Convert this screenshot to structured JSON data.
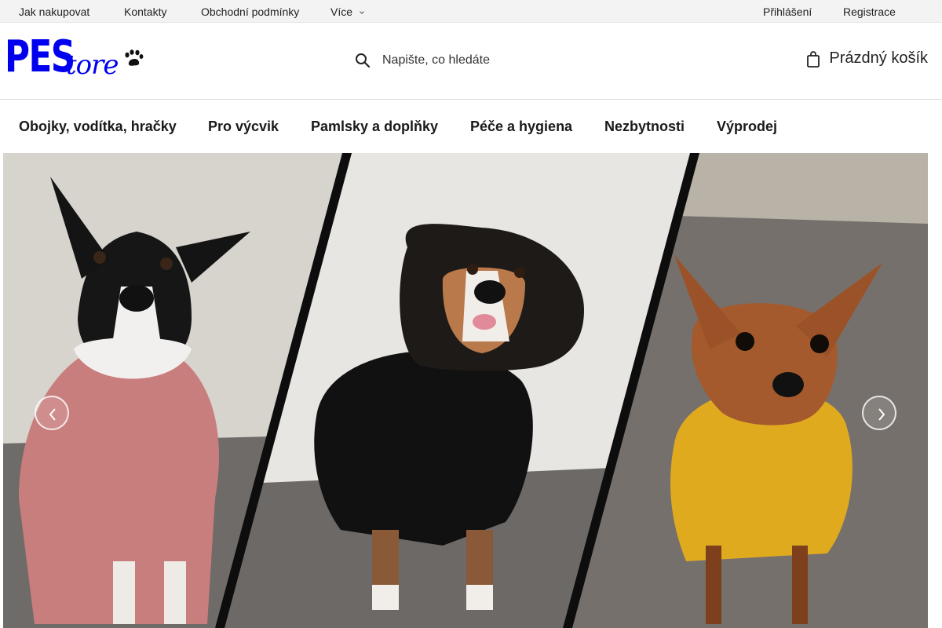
{
  "topbar": {
    "links": [
      "Jak nakupovat",
      "Kontakty",
      "Obchodní podmínky",
      "Více"
    ],
    "login": "Přihlášení",
    "register": "Registrace"
  },
  "header": {
    "logo": {
      "part1": "PES",
      "part2": "tore"
    },
    "search": {
      "placeholder": "Napište, co hledáte"
    },
    "cart": {
      "label": "Prázdný košík"
    }
  },
  "categories": [
    "Obojky, vodítka, hračky",
    "Pro výcvik",
    "Pamlsky a doplňky",
    "Péče a hygiena",
    "Nezbytnosti",
    "Výprodej"
  ],
  "hero": {
    "icons": {
      "prev": "chevron-left-icon",
      "next": "chevron-right-icon"
    }
  }
}
